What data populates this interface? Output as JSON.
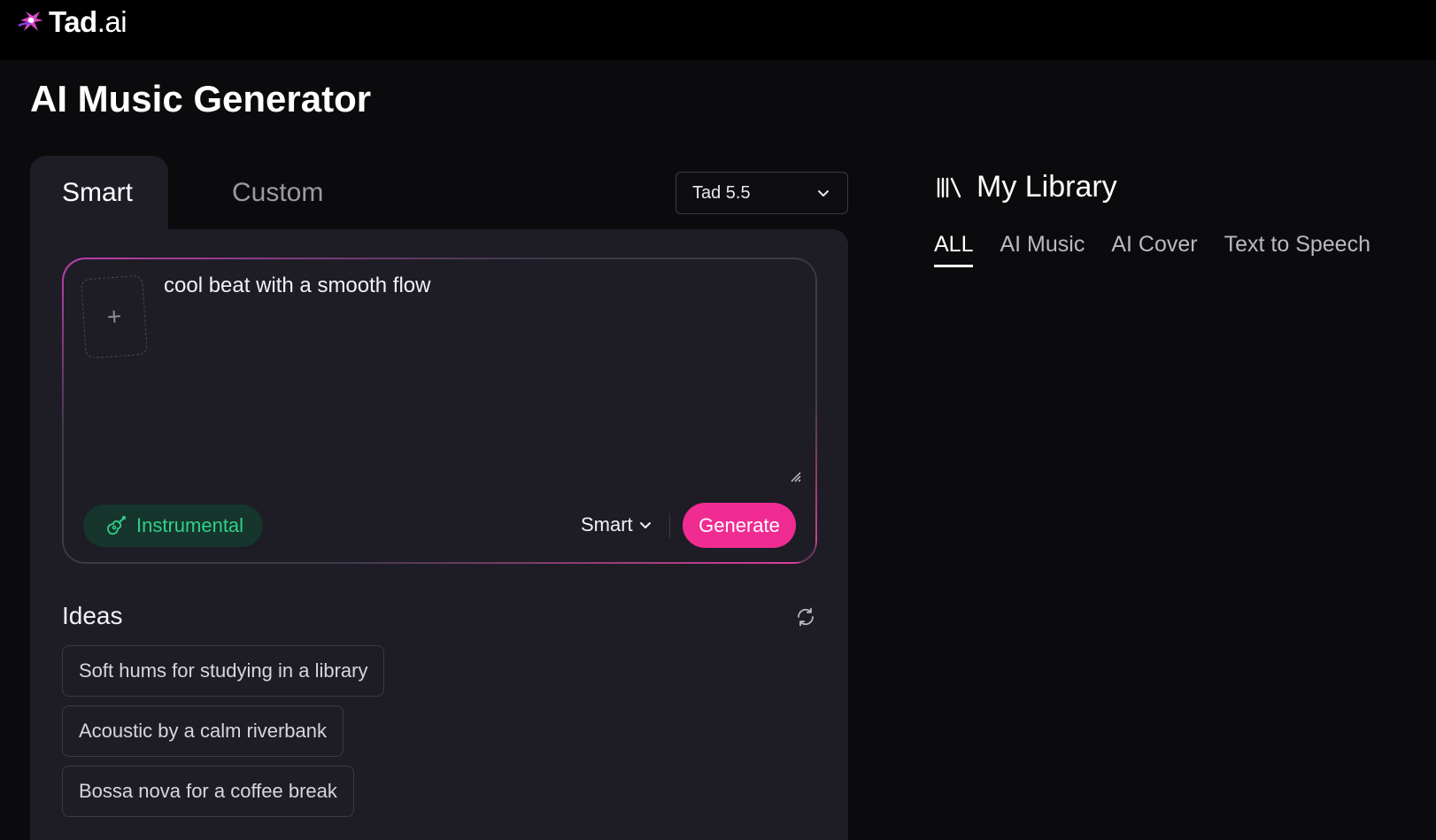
{
  "brand": {
    "name": "Tad",
    "suffix": ".ai"
  },
  "page": {
    "title": "AI Music Generator"
  },
  "tabs": {
    "smart": "Smart",
    "custom": "Custom"
  },
  "model_select": {
    "value": "Tad 5.5"
  },
  "prompt": {
    "text": "cool beat with a smooth flow",
    "upload_symbol": "+"
  },
  "controls": {
    "instrumental_label": "Instrumental",
    "mode_label": "Smart",
    "generate_label": "Generate"
  },
  "ideas": {
    "title": "Ideas",
    "items": [
      "Soft hums for studying in a library",
      "Acoustic by a calm riverbank",
      "Bossa nova for a coffee break"
    ]
  },
  "library": {
    "title": "My Library",
    "tabs": [
      "ALL",
      "AI Music",
      "AI Cover",
      "Text to Speech"
    ],
    "active_tab": "ALL"
  },
  "colors": {
    "accent": "#f02c93",
    "instrumental_green": "#2fd189",
    "panel_bg": "#1e1d26"
  },
  "icons": {
    "logo": "tad-logo-icon",
    "chevron": "chevron-down-icon",
    "guitar": "guitar-icon",
    "refresh": "refresh-icon",
    "library": "library-icon",
    "resize": "resize-handle-icon"
  }
}
